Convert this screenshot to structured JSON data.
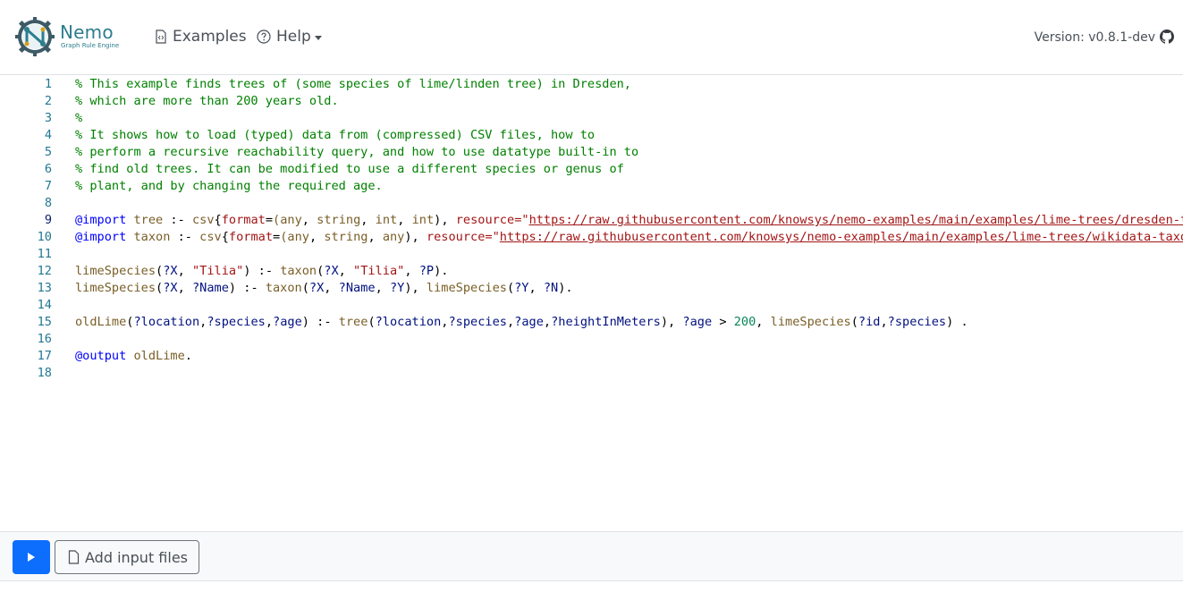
{
  "brand": {
    "name": "Nemo",
    "subtitle": "Graph Rule Engine",
    "logo_icon": "nemo-gear-logo",
    "color": "#2d7d8f"
  },
  "nav": {
    "examples_label": "Examples",
    "examples_icon": "file-code-icon",
    "help_label": "Help",
    "help_icon": "question-circle-icon"
  },
  "version": {
    "label": "Version: v0.8.1-dev",
    "github_icon": "github-icon"
  },
  "editor": {
    "active_line": 9,
    "line_numbers": [
      "1",
      "2",
      "3",
      "4",
      "5",
      "6",
      "7",
      "8",
      "9",
      "10",
      "11",
      "12",
      "13",
      "14",
      "15",
      "16",
      "17",
      "18"
    ],
    "lines": [
      [
        {
          "t": "% This example finds trees of (some species of lime/linden tree) in Dresden,",
          "c": "cm"
        }
      ],
      [
        {
          "t": "% which are more than 200 years old.",
          "c": "cm"
        }
      ],
      [
        {
          "t": "%",
          "c": "cm"
        }
      ],
      [
        {
          "t": "% It shows how to load (typed) data from (compressed) CSV files, how to",
          "c": "cm"
        }
      ],
      [
        {
          "t": "% perform a recursive reachability query, and how to use datatype built-in to",
          "c": "cm"
        }
      ],
      [
        {
          "t": "% find old trees. It can be modified to use a different species or genus of",
          "c": "cm"
        }
      ],
      [
        {
          "t": "% plant, and by changing the required age.",
          "c": "cm"
        }
      ],
      [],
      [
        {
          "t": "@import",
          "c": "dir"
        },
        {
          "t": " ",
          "c": "op"
        },
        {
          "t": "tree",
          "c": "pred"
        },
        {
          "t": " :- ",
          "c": "op"
        },
        {
          "t": "csv",
          "c": "pred"
        },
        {
          "t": "{",
          "c": "op"
        },
        {
          "t": "format",
          "c": "str"
        },
        {
          "t": "=",
          "c": "op"
        },
        {
          "t": "(",
          "c": "pred"
        },
        {
          "t": "any",
          "c": "pred"
        },
        {
          "t": ", ",
          "c": "op"
        },
        {
          "t": "string",
          "c": "pred"
        },
        {
          "t": ", ",
          "c": "op"
        },
        {
          "t": "int",
          "c": "pred"
        },
        {
          "t": ", ",
          "c": "op"
        },
        {
          "t": "int",
          "c": "pred"
        },
        {
          "t": "), ",
          "c": "op"
        },
        {
          "t": "resource",
          "c": "str"
        },
        {
          "t": "=\"",
          "c": "str"
        },
        {
          "t": "https://raw.githubusercontent.com/knowsys/nemo-examples/main/examples/lime-trees/dresden-trees-ages-heights.csv.gz",
          "c": "url"
        },
        {
          "t": "\"} .",
          "c": "str"
        }
      ],
      [
        {
          "t": "@import",
          "c": "dir"
        },
        {
          "t": " ",
          "c": "op"
        },
        {
          "t": "taxon",
          "c": "pred"
        },
        {
          "t": " :- ",
          "c": "op"
        },
        {
          "t": "csv",
          "c": "pred"
        },
        {
          "t": "{",
          "c": "op"
        },
        {
          "t": "format",
          "c": "str"
        },
        {
          "t": "=",
          "c": "op"
        },
        {
          "t": "(",
          "c": "pred"
        },
        {
          "t": "any",
          "c": "pred"
        },
        {
          "t": ", ",
          "c": "op"
        },
        {
          "t": "string",
          "c": "pred"
        },
        {
          "t": ", ",
          "c": "op"
        },
        {
          "t": "any",
          "c": "pred"
        },
        {
          "t": "), ",
          "c": "op"
        },
        {
          "t": "resource",
          "c": "str"
        },
        {
          "t": "=\"",
          "c": "str"
        },
        {
          "t": "https://raw.githubusercontent.com/knowsys/nemo-examples/main/examples/lime-trees/wikidata-taxon-name-parent.csv.gz",
          "c": "url"
        },
        {
          "t": "\"} .",
          "c": "str"
        }
      ],
      [],
      [
        {
          "t": "limeSpecies",
          "c": "pred"
        },
        {
          "t": "(",
          "c": "op"
        },
        {
          "t": "?X",
          "c": "var"
        },
        {
          "t": ", ",
          "c": "op"
        },
        {
          "t": "\"Tilia\"",
          "c": "str"
        },
        {
          "t": ") :- ",
          "c": "op"
        },
        {
          "t": "taxon",
          "c": "pred"
        },
        {
          "t": "(",
          "c": "op"
        },
        {
          "t": "?X",
          "c": "var"
        },
        {
          "t": ", ",
          "c": "op"
        },
        {
          "t": "\"Tilia\"",
          "c": "str"
        },
        {
          "t": ", ",
          "c": "op"
        },
        {
          "t": "?P",
          "c": "var"
        },
        {
          "t": ").",
          "c": "op"
        }
      ],
      [
        {
          "t": "limeSpecies",
          "c": "pred"
        },
        {
          "t": "(",
          "c": "op"
        },
        {
          "t": "?X",
          "c": "var"
        },
        {
          "t": ", ",
          "c": "op"
        },
        {
          "t": "?Name",
          "c": "var"
        },
        {
          "t": ") :- ",
          "c": "op"
        },
        {
          "t": "taxon",
          "c": "pred"
        },
        {
          "t": "(",
          "c": "op"
        },
        {
          "t": "?X",
          "c": "var"
        },
        {
          "t": ", ",
          "c": "op"
        },
        {
          "t": "?Name",
          "c": "var"
        },
        {
          "t": ", ",
          "c": "op"
        },
        {
          "t": "?Y",
          "c": "var"
        },
        {
          "t": "), ",
          "c": "op"
        },
        {
          "t": "limeSpecies",
          "c": "pred"
        },
        {
          "t": "(",
          "c": "op"
        },
        {
          "t": "?Y",
          "c": "var"
        },
        {
          "t": ", ",
          "c": "op"
        },
        {
          "t": "?N",
          "c": "var"
        },
        {
          "t": ").",
          "c": "op"
        }
      ],
      [],
      [
        {
          "t": "oldLime",
          "c": "pred"
        },
        {
          "t": "(",
          "c": "op"
        },
        {
          "t": "?location",
          "c": "var"
        },
        {
          "t": ",",
          "c": "op"
        },
        {
          "t": "?species",
          "c": "var"
        },
        {
          "t": ",",
          "c": "op"
        },
        {
          "t": "?age",
          "c": "var"
        },
        {
          "t": ") :- ",
          "c": "op"
        },
        {
          "t": "tree",
          "c": "pred"
        },
        {
          "t": "(",
          "c": "op"
        },
        {
          "t": "?location",
          "c": "var"
        },
        {
          "t": ",",
          "c": "op"
        },
        {
          "t": "?species",
          "c": "var"
        },
        {
          "t": ",",
          "c": "op"
        },
        {
          "t": "?age",
          "c": "var"
        },
        {
          "t": ",",
          "c": "op"
        },
        {
          "t": "?heightInMeters",
          "c": "var"
        },
        {
          "t": "), ",
          "c": "op"
        },
        {
          "t": "?age",
          "c": "var"
        },
        {
          "t": " > ",
          "c": "op"
        },
        {
          "t": "200",
          "c": "num"
        },
        {
          "t": ", ",
          "c": "op"
        },
        {
          "t": "limeSpecies",
          "c": "pred"
        },
        {
          "t": "(",
          "c": "op"
        },
        {
          "t": "?id",
          "c": "var"
        },
        {
          "t": ",",
          "c": "op"
        },
        {
          "t": "?species",
          "c": "var"
        },
        {
          "t": ") .",
          "c": "op"
        }
      ],
      [],
      [
        {
          "t": "@output",
          "c": "dir"
        },
        {
          "t": " ",
          "c": "op"
        },
        {
          "t": "oldLime",
          "c": "pred"
        },
        {
          "t": ".",
          "c": "op"
        }
      ],
      []
    ]
  },
  "toolbar": {
    "run_icon": "play-icon",
    "add_files_label": "Add input files",
    "add_files_icon": "file-icon",
    "run_color": "#0d6efd"
  }
}
